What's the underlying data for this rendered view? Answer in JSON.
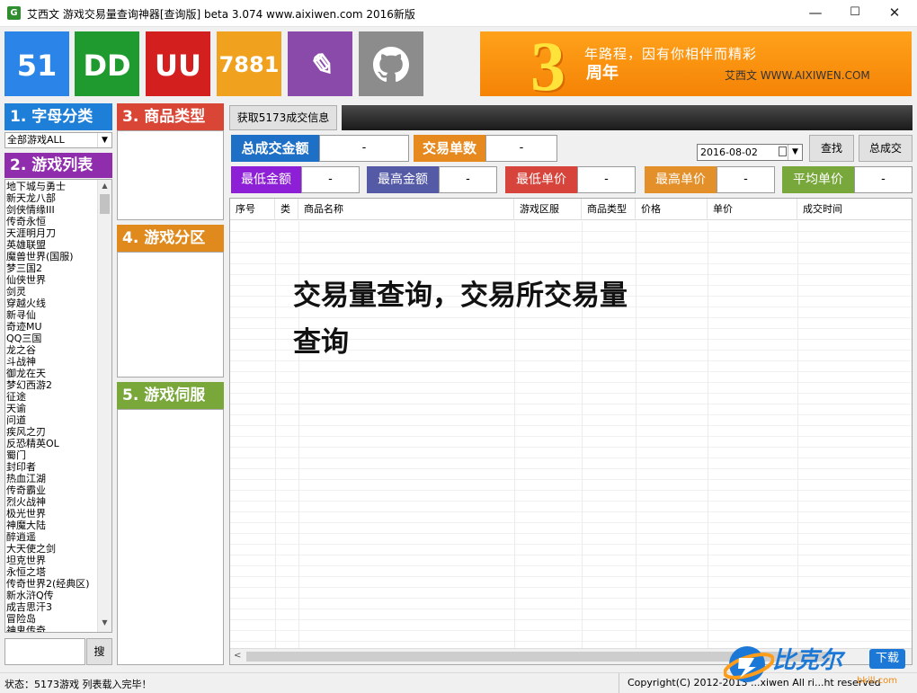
{
  "window": {
    "title": "艾西文 游戏交易量查询神器[查询版] beta 3.074 www.aixiwen.com 2016新版",
    "app_icon": "G",
    "minimize_glyph": "—",
    "maximize_glyph": "☐",
    "close_glyph": "✕"
  },
  "tiles": [
    {
      "label": "51",
      "color": "#2b84e8"
    },
    {
      "label": "DD",
      "color": "#1f9a2e"
    },
    {
      "label": "UU",
      "color": "#d41f1f"
    },
    {
      "label": "7881",
      "color": "#f0a11e"
    },
    {
      "label": "✎",
      "icon": "script-logo-icon",
      "color": "#8a4aa9"
    },
    {
      "label": "",
      "icon": "github-icon",
      "color": "#8c8c8c"
    }
  ],
  "banner": {
    "big_digit": "3",
    "slogan": "年路程，因有你相伴而精彩",
    "years_label": "周年",
    "site": "艾西文 WWW.AIXIWEN.COM"
  },
  "sections": {
    "letter_category": "1. 字母分类",
    "game_list": "2. 游戏列表",
    "product_type": "3. 商品类型",
    "game_zone": "4. 游戏分区",
    "game_server": "5. 游戏伺服"
  },
  "letter_select_value": "全部游戏ALL",
  "games": [
    "地下城与勇士",
    "新天龙八部",
    "剑侠情缘III",
    "传奇永恒",
    "天涯明月刀",
    "英雄联盟",
    "魔兽世界(国服)",
    "梦三国2",
    "仙侠世界",
    "剑灵",
    "穿越火线",
    "新寻仙",
    "奇迹MU",
    "QQ三国",
    "龙之谷",
    "斗战神",
    "御龙在天",
    "梦幻西游2",
    "征途",
    "天谕",
    "问道",
    "疾风之刃",
    "反恐精英OL",
    "蜀门",
    "封印者",
    "热血江湖",
    "传奇霸业",
    "烈火战神",
    "极光世界",
    "神魔大陆",
    "醉逍遥",
    "大天使之剑",
    "坦克世界",
    "永恒之塔",
    "传奇世界2(经典区)",
    "新水浒Q传",
    "成吉思汗3",
    "冒险岛",
    "神鬼传奇"
  ],
  "search": {
    "value": "",
    "button": "搜"
  },
  "fetch_button": "获取5173成交信息",
  "summary": {
    "total_amount_label": "总成交金额",
    "total_amount_value": "-",
    "order_count_label": "交易单数",
    "order_count_value": "-",
    "date_value": "2016-08-02",
    "find_button": "查找",
    "total_button": "总成交"
  },
  "stats": [
    {
      "label": "最低金额",
      "value": "-",
      "color": "#8d1fd6"
    },
    {
      "label": "最高金额",
      "value": "-",
      "color": "#545aa6"
    },
    {
      "label": "最低单价",
      "value": "-",
      "color": "#d6443c"
    },
    {
      "label": "最高单价",
      "value": "-",
      "color": "#e3902a"
    },
    {
      "label": "平均单价",
      "value": "-",
      "color": "#78a83c"
    }
  ],
  "table": {
    "columns": [
      "序号",
      "类",
      "商品名称",
      "游戏区服",
      "商品类型",
      "价格",
      "单价",
      "成交时间"
    ],
    "rows": []
  },
  "overlay_title": "交易量查询，交易所交易量查询",
  "status": {
    "left": "状态：5173游戏 列表载入完毕！",
    "right": "Copyright(C) 2012-2013 ...xiwen All ri...ht reserved"
  },
  "watermark": {
    "text": "比克尔",
    "badge": "下载",
    "sub": "bkill.com"
  },
  "colors": {
    "blue_header": "#1e7fd8",
    "purple_header": "#8f2dac",
    "red_header": "#d94636",
    "orange_header": "#e08a1e",
    "green_header": "#79a73a"
  }
}
